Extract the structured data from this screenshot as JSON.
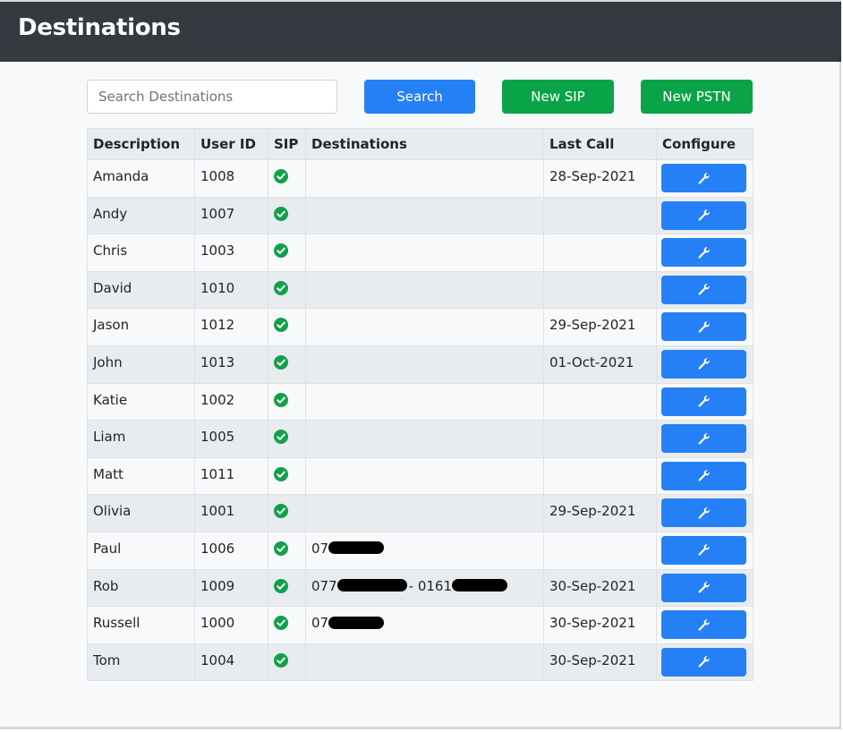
{
  "header": {
    "title": "Destinations"
  },
  "search": {
    "placeholder": "Search Destinations",
    "value": ""
  },
  "toolbar": {
    "search_label": "Search",
    "new_sip_label": "New SIP",
    "new_pstn_label": "New PSTN"
  },
  "table": {
    "columns": [
      "Description",
      "User ID",
      "SIP",
      "Destinations",
      "Last Call",
      "Configure"
    ],
    "rows": [
      {
        "description": "Amanda",
        "user_id": "1008",
        "sip": "check-circle-icon",
        "destinations": "",
        "last_call": "28-Sep-2021",
        "configure": "wrench-icon"
      },
      {
        "description": "Andy",
        "user_id": "1007",
        "sip": "check-circle-icon",
        "destinations": "",
        "last_call": "",
        "configure": "wrench-icon"
      },
      {
        "description": "Chris",
        "user_id": "1003",
        "sip": "check-circle-icon",
        "destinations": "",
        "last_call": "",
        "configure": "wrench-icon"
      },
      {
        "description": "David",
        "user_id": "1010",
        "sip": "check-circle-icon",
        "destinations": "",
        "last_call": "",
        "configure": "wrench-icon"
      },
      {
        "description": "Jason",
        "user_id": "1012",
        "sip": "check-circle-icon",
        "destinations": "",
        "last_call": "29-Sep-2021",
        "configure": "wrench-icon"
      },
      {
        "description": "John",
        "user_id": "1013",
        "sip": "check-circle-icon",
        "destinations": "",
        "last_call": "01-Oct-2021",
        "configure": "wrench-icon"
      },
      {
        "description": "Katie",
        "user_id": "1002",
        "sip": "check-circle-icon",
        "destinations": "",
        "last_call": "",
        "configure": "wrench-icon"
      },
      {
        "description": "Liam",
        "user_id": "1005",
        "sip": "check-circle-icon",
        "destinations": "",
        "last_call": "",
        "configure": "wrench-icon"
      },
      {
        "description": "Matt",
        "user_id": "1011",
        "sip": "check-circle-icon",
        "destinations": "",
        "last_call": "",
        "configure": "wrench-icon"
      },
      {
        "description": "Olivia",
        "user_id": "1001",
        "sip": "check-circle-icon",
        "destinations": "",
        "last_call": "29-Sep-2021",
        "configure": "wrench-icon"
      },
      {
        "description": "Paul",
        "user_id": "1006",
        "sip": "check-circle-icon",
        "destinations": [
          {
            "text": "07"
          },
          {
            "redacted": true
          }
        ],
        "last_call": "",
        "configure": "wrench-icon"
      },
      {
        "description": "Rob",
        "user_id": "1009",
        "sip": "check-circle-icon",
        "destinations": [
          {
            "text": "077"
          },
          {
            "redacted": true
          },
          {
            "text": "- 0161"
          },
          {
            "redacted": true
          }
        ],
        "last_call": "30-Sep-2021",
        "configure": "wrench-icon"
      },
      {
        "description": "Russell",
        "user_id": "1000",
        "sip": "check-circle-icon",
        "destinations": [
          {
            "text": "07"
          },
          {
            "redacted": true
          }
        ],
        "last_call": "30-Sep-2021",
        "configure": "wrench-icon"
      },
      {
        "description": "Tom",
        "user_id": "1004",
        "sip": "check-circle-icon",
        "destinations": "",
        "last_call": "30-Sep-2021",
        "configure": "wrench-icon"
      }
    ]
  },
  "colors": {
    "navbar": "#343a40",
    "primary": "#2680f5",
    "success": "#0aa448",
    "check": "#13a04a"
  }
}
